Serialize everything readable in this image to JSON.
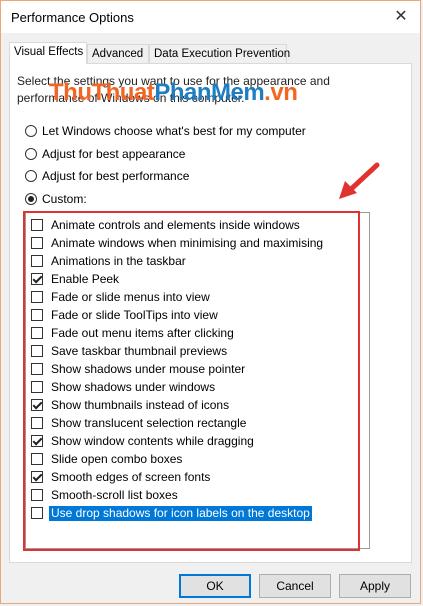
{
  "window": {
    "title": "Performance Options",
    "close_glyph": "✕"
  },
  "tabs": [
    {
      "label": "Visual Effects",
      "active": true
    },
    {
      "label": "Advanced",
      "active": false
    },
    {
      "label": "Data Execution Prevention",
      "active": false
    }
  ],
  "description": {
    "line1": "Select the settings you want to use for the appearance and",
    "line2": "performance of Windows on this computer."
  },
  "watermark": {
    "part1": "ThuThuat",
    "part2": "PhanMem",
    "part3": ".vn"
  },
  "radios": [
    {
      "label": "Let Windows choose what's best for my computer",
      "checked": false
    },
    {
      "label": "Adjust for best appearance",
      "checked": false
    },
    {
      "label": "Adjust for best performance",
      "checked": false
    },
    {
      "label": "Custom:",
      "checked": true
    }
  ],
  "effects": [
    {
      "label": "Animate controls and elements inside windows",
      "checked": false
    },
    {
      "label": "Animate windows when minimising and maximising",
      "checked": false
    },
    {
      "label": "Animations in the taskbar",
      "checked": false
    },
    {
      "label": "Enable Peek",
      "checked": true
    },
    {
      "label": "Fade or slide menus into view",
      "checked": false
    },
    {
      "label": "Fade or slide ToolTips into view",
      "checked": false
    },
    {
      "label": "Fade out menu items after clicking",
      "checked": false
    },
    {
      "label": "Save taskbar thumbnail previews",
      "checked": false
    },
    {
      "label": "Show shadows under mouse pointer",
      "checked": false
    },
    {
      "label": "Show shadows under windows",
      "checked": false
    },
    {
      "label": "Show thumbnails instead of icons",
      "checked": true
    },
    {
      "label": "Show translucent selection rectangle",
      "checked": false
    },
    {
      "label": "Show window contents while dragging",
      "checked": true
    },
    {
      "label": "Slide open combo boxes",
      "checked": false
    },
    {
      "label": "Smooth edges of screen fonts",
      "checked": true
    },
    {
      "label": "Smooth-scroll list boxes",
      "checked": false
    },
    {
      "label": "Use drop shadows for icon labels on the desktop",
      "checked": false,
      "selected": true
    }
  ],
  "buttons": {
    "ok": "OK",
    "cancel": "Cancel",
    "apply": "Apply"
  },
  "colors": {
    "annotation_red": "#e0332f",
    "selection_blue": "#0078d7",
    "watermark_orange": "#f26522",
    "watermark_blue": "#1f7ec2"
  }
}
